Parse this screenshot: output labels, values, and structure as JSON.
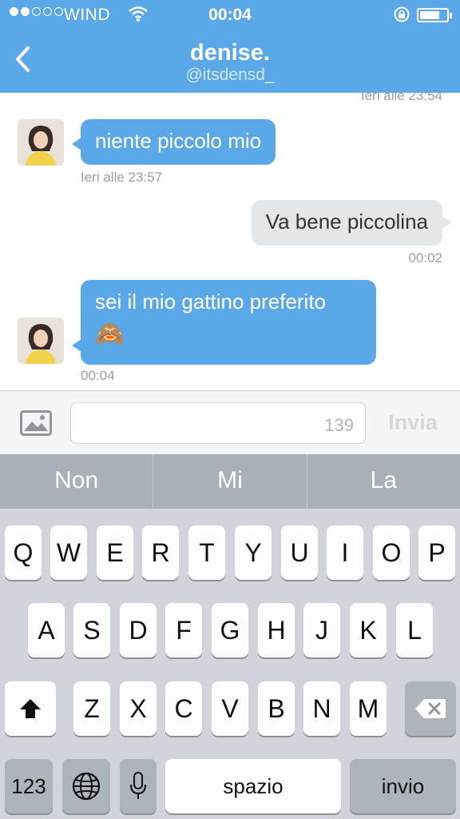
{
  "status_bar": {
    "carrier": "WIND",
    "time": "00:04"
  },
  "nav": {
    "title": "denise.",
    "handle": "@itsdensd_"
  },
  "messages": [
    {
      "direction": "incoming",
      "text": "niente piccolo mio",
      "time": "Ieri alle 23:57"
    },
    {
      "direction": "outgoing",
      "text": "Va bene piccolina",
      "time": "00:02"
    },
    {
      "direction": "incoming",
      "text": "sei il mio gattino preferito",
      "emoji": "🙈",
      "time": "00:04"
    }
  ],
  "top_partial_time": "Ieri alle 23:54",
  "compose": {
    "char_count": "139",
    "send_label": "Invia"
  },
  "suggestions": [
    "Non",
    "Mi",
    "La"
  ],
  "keyboard": {
    "row1": [
      "Q",
      "W",
      "E",
      "R",
      "T",
      "Y",
      "U",
      "I",
      "O",
      "P"
    ],
    "row2": [
      "A",
      "S",
      "D",
      "F",
      "G",
      "H",
      "J",
      "K",
      "L"
    ],
    "row3": [
      "Z",
      "X",
      "C",
      "V",
      "B",
      "N",
      "M"
    ],
    "numbers_label": "123",
    "space_label": "spazio",
    "return_label": "invio"
  },
  "colors": {
    "accent": "#5aa8e8",
    "outgoing_bubble": "#e3e7ea",
    "keyboard_bg": "#d1d5db"
  }
}
